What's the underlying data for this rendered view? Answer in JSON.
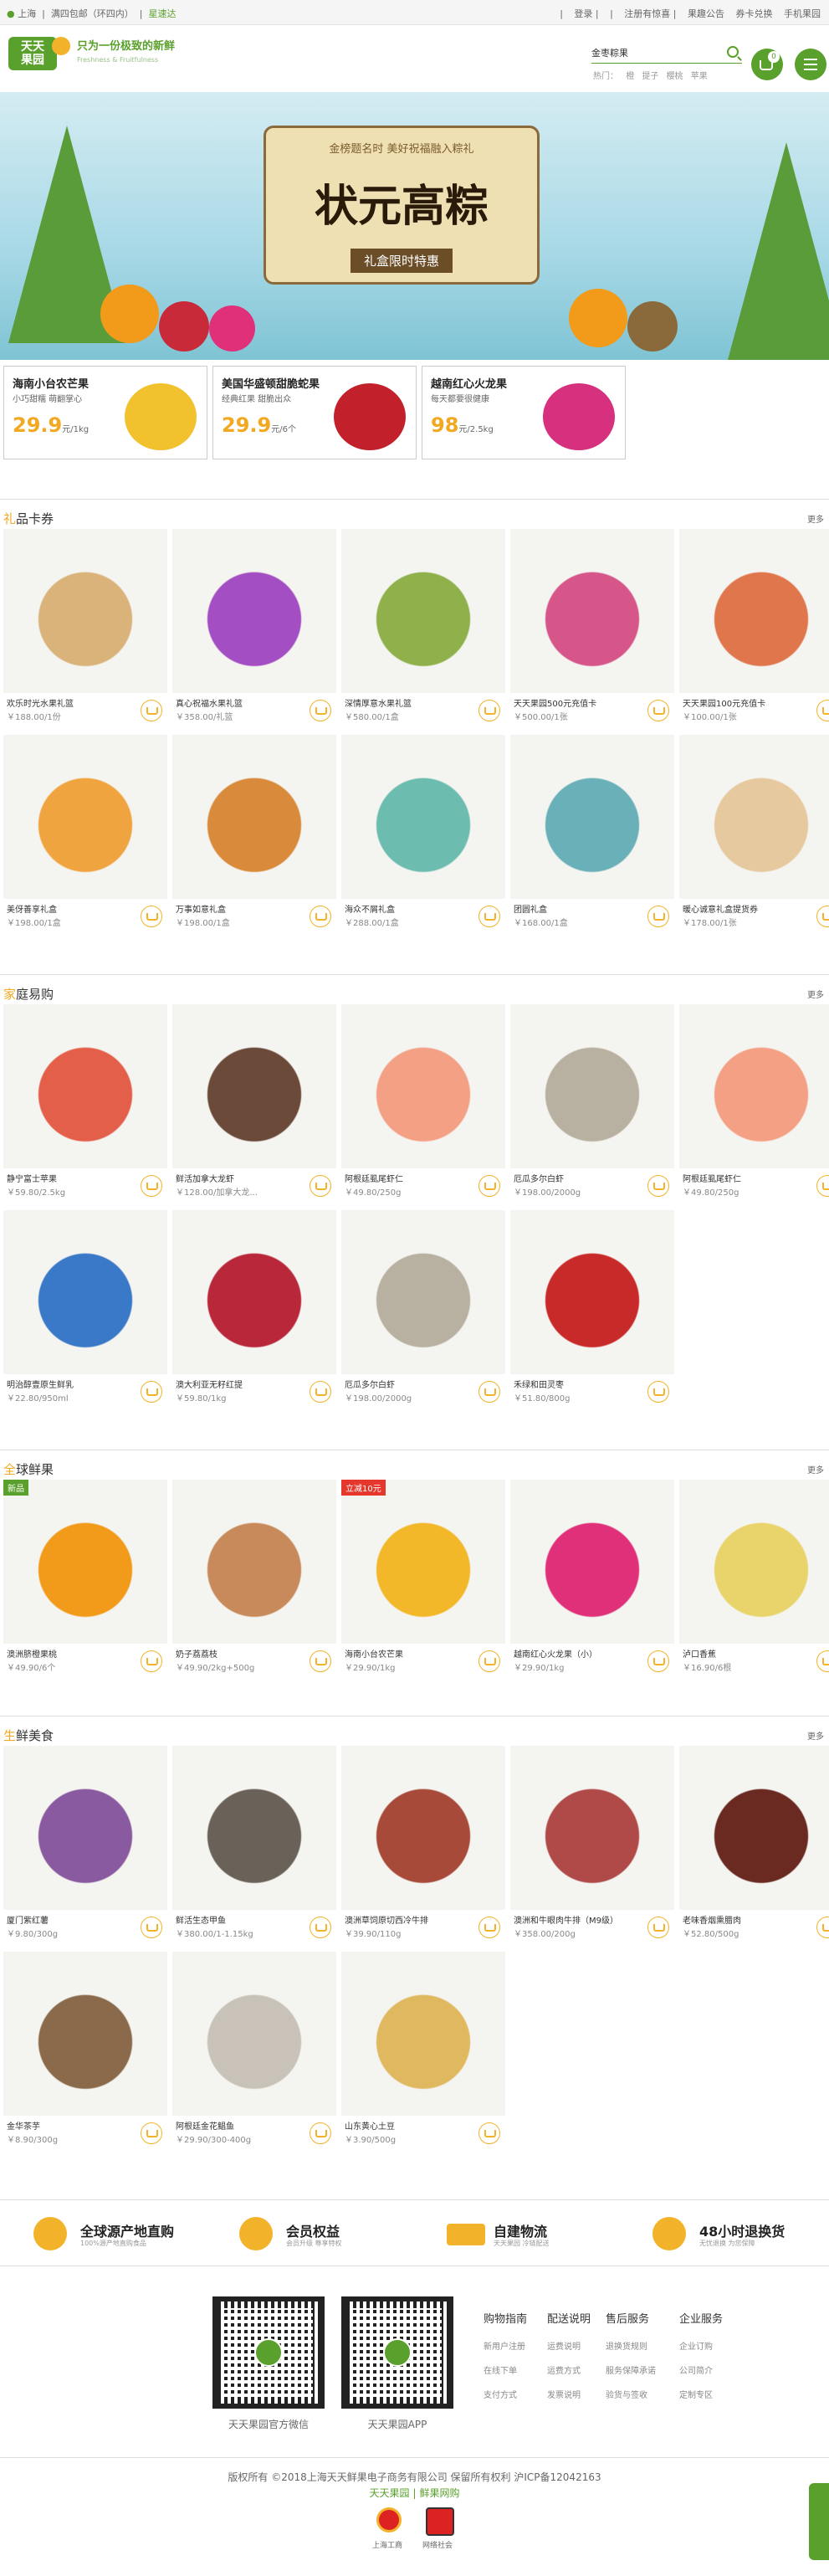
{
  "topbar": {
    "location": "上海",
    "shipping": "满四包邮（环四内）",
    "delivery": "星速达",
    "login": "登录",
    "register": "注册有惊喜",
    "notice": "果趣公告",
    "card": "券卡兑换",
    "mobile": "手机果园"
  },
  "header": {
    "logo_text": "天天果园",
    "slogan": "只为一份极致的新鲜",
    "slogan_sub": "Freshness & Fruitfulness",
    "search_value": "金枣粽果",
    "hot_label": "热门：",
    "hot_terms": [
      "橙",
      "提子",
      "樱桃",
      "苹果"
    ],
    "cart_count": "0"
  },
  "banner": {
    "top_text": "金榜题名时 美好祝福融入粽礼",
    "title": "状元高粽",
    "tag": "礼盒限时特惠"
  },
  "promos": [
    {
      "title": "海南小台农芒果",
      "sub": "小巧甜糯 萌翻掌心",
      "price": "29.9",
      "unit": "元/1kg",
      "color": "#f2c12e"
    },
    {
      "title": "美国华盛顿甜脆蛇果",
      "sub": "经典红果 甜脆出众",
      "price": "29.9",
      "unit": "元/6个",
      "color": "#c2202b"
    },
    {
      "title": "越南红心火龙果",
      "sub": "每天都要很健康",
      "price": "98",
      "unit": "元/2.5kg",
      "color": "#d6307e"
    }
  ],
  "sections": [
    {
      "title_head": "礼",
      "title_rest": "品卡券",
      "more": "更多",
      "items": [
        {
          "name": "欢乐时光水果礼篮",
          "price": "￥188.00/1份",
          "color": "#d9b37a"
        },
        {
          "name": "真心祝福水果礼篮",
          "price": "￥358.00/礼篮",
          "color": "#a34ec2"
        },
        {
          "name": "深情厚意水果礼篮",
          "price": "￥580.00/1盒",
          "color": "#8fb04a"
        },
        {
          "name": "天天果园500元充值卡",
          "price": "￥500.00/1张",
          "color": "#d6568a"
        },
        {
          "name": "天天果园100元充值卡",
          "price": "￥100.00/1张",
          "color": "#e0764c"
        },
        {
          "name": "美伢善享礼盒",
          "price": "￥198.00/1盒",
          "color": "#f0a440"
        },
        {
          "name": "万事如意礼盒",
          "price": "￥198.00/1盒",
          "color": "#d98a3a"
        },
        {
          "name": "海众不屑礼盒",
          "price": "￥288.00/1盒",
          "color": "#6cbcb0"
        },
        {
          "name": "团圆礼盒",
          "price": "￥168.00/1盒",
          "color": "#6ab0b8"
        },
        {
          "name": "暖心诚意礼盒提货券",
          "price": "￥178.00/1张",
          "color": "#e7c9a0"
        }
      ]
    },
    {
      "title_head": "家",
      "title_rest": "庭易购",
      "more": "更多",
      "items": [
        {
          "name": "静宁富士苹果",
          "price": "￥59.80/2.5kg",
          "color": "#e45f4a"
        },
        {
          "name": "鲜活加拿大龙虾",
          "price": "￥128.00/加拿大龙...",
          "color": "#6b4a3a"
        },
        {
          "name": "阿根廷虱尾虾仁",
          "price": "￥49.80/250g",
          "color": "#f4a085"
        },
        {
          "name": "厄瓜多尔白虾",
          "price": "￥198.00/2000g",
          "color": "#b8b0a0"
        },
        {
          "name": "阿根廷虱尾虾仁",
          "price": "￥49.80/250g",
          "color": "#f4a085"
        },
        {
          "name": "明治醇壹原生鲜乳",
          "price": "￥22.80/950ml",
          "color": "#3a78c8"
        },
        {
          "name": "澳大利亚无籽红提",
          "price": "￥59.80/1kg",
          "color": "#b8283a"
        },
        {
          "name": "厄瓜多尔白虾",
          "price": "￥198.00/2000g",
          "color": "#b8b0a0"
        },
        {
          "name": "禾绿和田灵枣",
          "price": "￥51.80/800g",
          "color": "#c82a2a"
        }
      ]
    },
    {
      "title_head": "全",
      "title_rest": "球鲜果",
      "more": "更多",
      "items": [
        {
          "name": "澳洲脐橙果桃",
          "price": "￥49.90/6个",
          "color": "#f29a1a",
          "label": "新品",
          "label_red": false
        },
        {
          "name": "奶子荔荔枝",
          "price": "￥49.90/2kg+500g",
          "color": "#c88a5a",
          "label": "",
          "label_red": false
        },
        {
          "name": "海南小台农芒果",
          "price": "￥29.90/1kg",
          "color": "#f2b82a",
          "label": "立减10元",
          "label_red": true
        },
        {
          "name": "越南红心火龙果（小）",
          "price": "￥29.90/1kg",
          "color": "#e0307a",
          "label": "",
          "label_red": false
        },
        {
          "name": "泸口香蕉",
          "price": "￥16.90/6根",
          "color": "#e8d46a",
          "label": "",
          "label_red": false
        }
      ]
    },
    {
      "title_head": "生",
      "title_rest": "鲜美食",
      "more": "更多",
      "items": [
        {
          "name": "厦门紫红薯",
          "price": "￥9.80/300g",
          "color": "#8a5aa0"
        },
        {
          "name": "鲜活生态甲鱼",
          "price": "￥380.00/1-1.15kg",
          "color": "#6a6258"
        },
        {
          "name": "澳洲草饲原切西冷牛排",
          "price": "￥39.90/110g",
          "color": "#a84a3a"
        },
        {
          "name": "澳洲和牛眼肉牛排（M9级）",
          "price": "￥358.00/200g",
          "color": "#b04a48"
        },
        {
          "name": "老味香烟熏腊肉",
          "price": "￥52.80/500g",
          "color": "#6a2a22"
        },
        {
          "name": "金华茶芋",
          "price": "￥8.90/300g",
          "color": "#8a6a4a"
        },
        {
          "name": "阿根廷金花鲳鱼",
          "price": "￥29.90/300-400g",
          "color": "#c8c2b8"
        },
        {
          "name": "山东黄心土豆",
          "price": "￥3.90/500g",
          "color": "#e0b860"
        }
      ]
    }
  ],
  "services": [
    {
      "title": "全球源产地直购",
      "sub": "100%源产地直购食品"
    },
    {
      "title": "会员权益",
      "sub": "会员升级 尊享特权"
    },
    {
      "title": "自建物流",
      "sub": "天天果园 冷链配送"
    },
    {
      "title": "48小时退换货",
      "sub": "无忧退换 为您保障"
    }
  ],
  "footer": {
    "qr1_label": "天天果园官方微信",
    "qr2_label": "天天果园APP",
    "cols": [
      {
        "head": "购物指南",
        "items": [
          "新用户注册",
          "在线下单",
          "支付方式"
        ]
      },
      {
        "head": "配送说明",
        "items": [
          "运费说明",
          "运费方式",
          "发票说明"
        ]
      },
      {
        "head": "售后服务",
        "items": [
          "退换货规则",
          "服务保障承诺",
          "验货与签收"
        ]
      },
      {
        "head": "企业服务",
        "items": [
          "企业订购",
          "公司简介",
          "定制专区"
        ]
      }
    ],
    "copyright": "版权所有 ©2018上海天天鲜果电子商务有限公司 保留所有权利 沪ICP备12042163",
    "link1": "天天果园",
    "link2": "鲜果网购",
    "badge1": "上海工商",
    "badge2": "网络社会"
  },
  "colors": {
    "brand": "#5aa02c",
    "accent": "#f2a820"
  }
}
